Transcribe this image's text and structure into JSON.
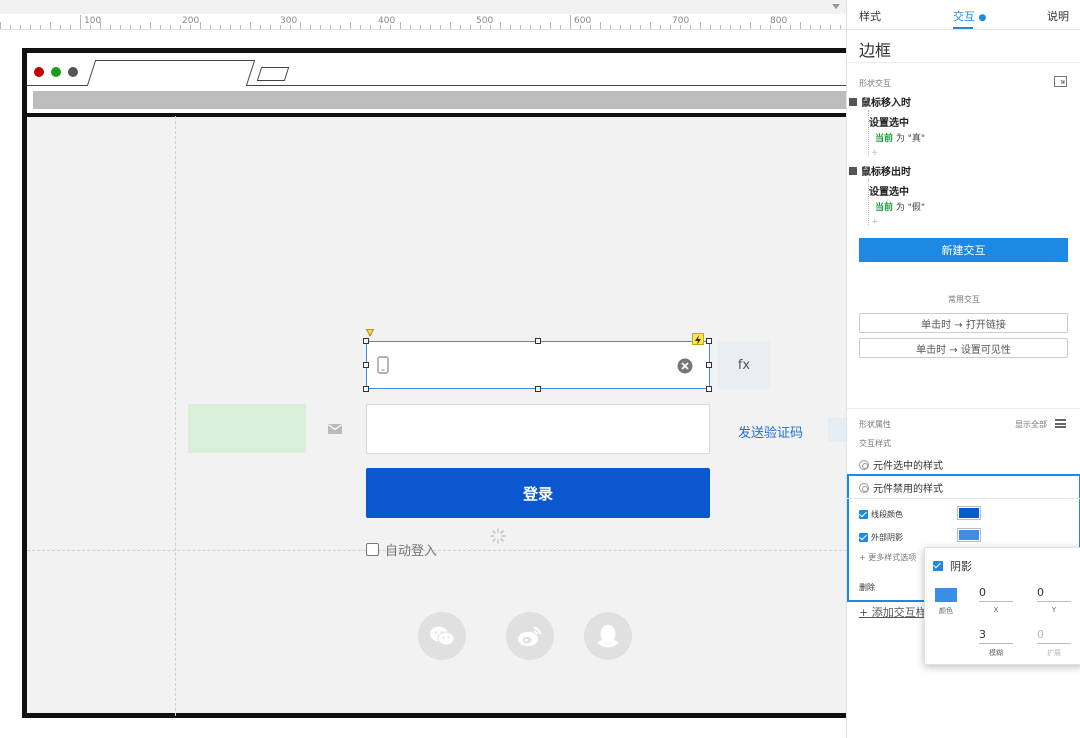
{
  "ruler": {
    "labels": [
      "100",
      "200",
      "300",
      "400",
      "500",
      "600",
      "700",
      "800"
    ]
  },
  "colors": {
    "accent": "#1e88e5",
    "login_button": "#0b57d0",
    "border_swatch": "#0b57d0",
    "shadow_swatch": "#3a8ee6",
    "dot_red": "#c00000",
    "dot_green": "#1a9e1a",
    "dot_gray": "#555555"
  },
  "canvas": {
    "fx_label": "fx",
    "send_code_label": "发送验证码",
    "login_label": "登录",
    "auto_login_label": "自动登入"
  },
  "panel": {
    "tabs": {
      "style": "样式",
      "interact": "交互",
      "notes": "说明"
    },
    "title": "边框",
    "shape_interactions_label": "形状交互",
    "events": [
      {
        "name": "鼠标移入时",
        "action": "设置选中",
        "target": "当前",
        "rest": " 为 \"真\""
      },
      {
        "name": "鼠标移出时",
        "action": "设置选中",
        "target": "当前",
        "rest": " 为 \"假\""
      }
    ],
    "plus": "+",
    "new_interaction": "新建交互",
    "common_title": "常用交互",
    "common": [
      "单击时 → 打开链接",
      "单击时 → 设置可见性"
    ],
    "props_label": "形状属性",
    "show_all": "显示全部",
    "interaction_styles_label": "交互样式",
    "selected_style": "元件选中的样式",
    "disabled_style": "元件禁用的样式",
    "border_color": "线段颜色",
    "outer_shadow": "外部阴影",
    "more_options": "+ 更多样式选项",
    "delete": "删除",
    "add_style": "+ 添加交互样式"
  },
  "shadow_popup": {
    "title": "阴影",
    "color_label": "颜色",
    "x_value": "0",
    "x_label": "X",
    "y_value": "0",
    "y_label": "Y",
    "blur_value": "3",
    "blur_label": "模糊",
    "spread_value": "0",
    "spread_label": "扩展"
  }
}
